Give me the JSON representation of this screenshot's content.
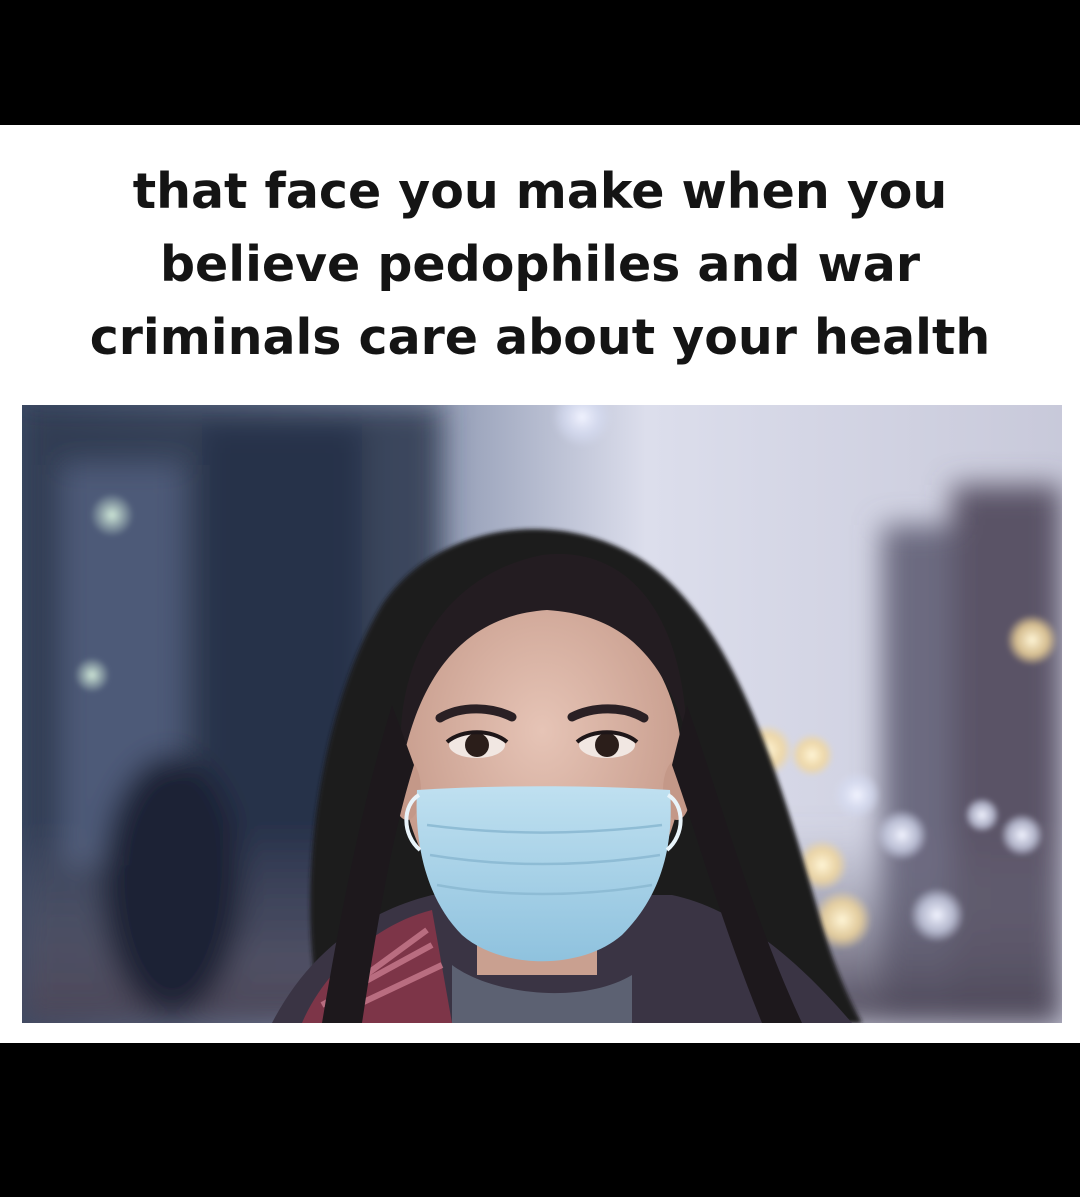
{
  "caption": {
    "line1": "that face you make when you",
    "line2": "believe pedophiles and war",
    "line3": "criminals care about your health"
  },
  "photo": {
    "subject": "woman wearing a blue surgical face mask on a blurred city street",
    "colors": {
      "sky": "#d9dbe9",
      "hair": "#1f1a1e",
      "skin": "#d8b4a6",
      "mask": "#a9d3ea",
      "scarf": "#7d3548"
    }
  },
  "colors": {
    "background": "#000000",
    "card": "#ffffff",
    "caption_text": "#141414"
  }
}
